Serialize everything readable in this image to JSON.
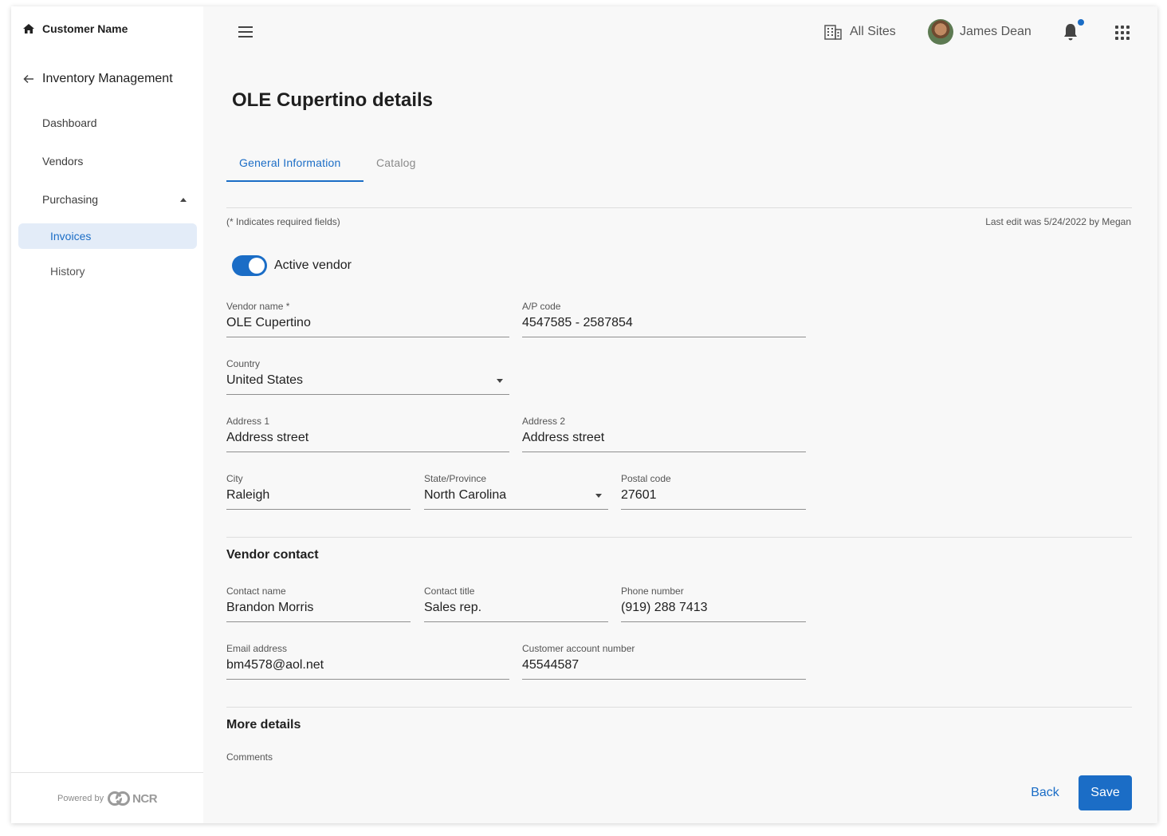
{
  "sidebar": {
    "customer_name": "Customer Name",
    "module": "Inventory Management",
    "items": [
      "Dashboard",
      "Vendors",
      "Purchasing"
    ],
    "active_item": "Invoices",
    "sub_item": "History",
    "powered_by": "Powered by",
    "brand": "NCR"
  },
  "topbar": {
    "sites": "All Sites",
    "user_name": "James Dean",
    "accent_color": "#1b6dc6"
  },
  "page": {
    "title": "OLE Cupertino details",
    "tabs": [
      "General Information",
      "Catalog"
    ],
    "required_note": "(* Indicates required fields)",
    "last_edit": "Last edit was 5/24/2022 by Megan",
    "toggle_label": "Active vendor",
    "toggle_on": true
  },
  "form": {
    "vendor_name": {
      "label": "Vendor name *",
      "value": "OLE Cupertino"
    },
    "ap_code": {
      "label": "A/P code",
      "value": "4547585 - 2587854"
    },
    "country": {
      "label": "Country",
      "value": "United States"
    },
    "address1": {
      "label": "Address 1",
      "value": "Address street"
    },
    "address2": {
      "label": "Address 2",
      "value": "Address street"
    },
    "city": {
      "label": "City",
      "value": "Raleigh"
    },
    "state": {
      "label": "State/Province",
      "value": "North Carolina"
    },
    "postal": {
      "label": "Postal code",
      "value": "27601"
    }
  },
  "contact": {
    "heading": "Vendor contact",
    "name": {
      "label": "Contact name",
      "value": "Brandon Morris"
    },
    "title": {
      "label": "Contact title",
      "value": "Sales rep."
    },
    "phone": {
      "label": "Phone number",
      "value": "(919) 288 7413"
    },
    "email": {
      "label": "Email address",
      "value": "bm4578@aol.net"
    },
    "account": {
      "label": "Customer account number",
      "value": "45544587"
    }
  },
  "more": {
    "heading": "More details",
    "comments_label": "Comments"
  },
  "actions": {
    "back": "Back",
    "save": "Save"
  }
}
